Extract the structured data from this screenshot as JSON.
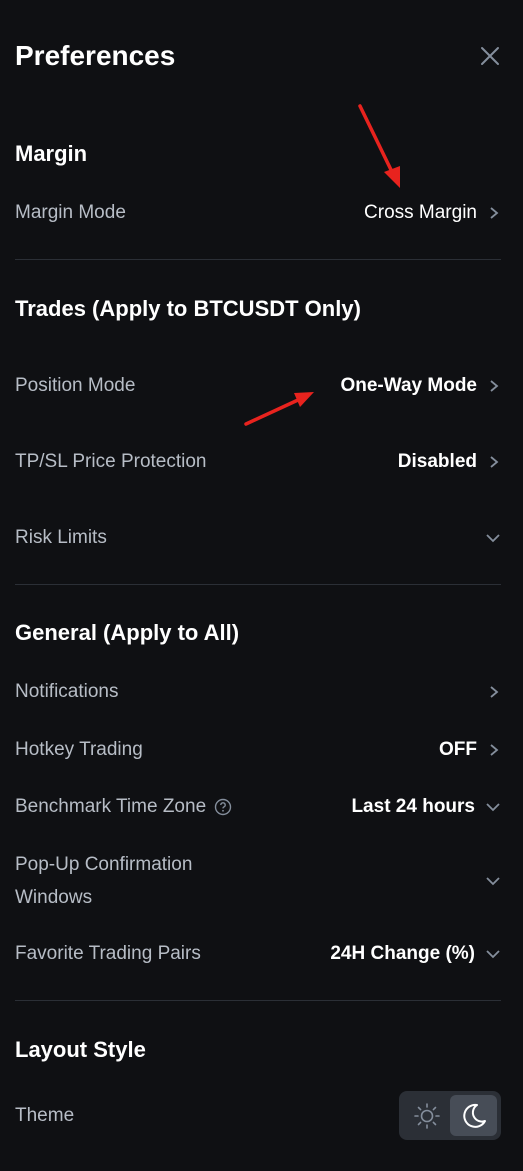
{
  "header": {
    "title": "Preferences"
  },
  "margin": {
    "section_title": "Margin",
    "mode_label": "Margin Mode",
    "mode_value": "Cross Margin"
  },
  "trades": {
    "section_title": "Trades (Apply to BTCUSDT Only)",
    "position_mode_label": "Position Mode",
    "position_mode_value": "One-Way Mode",
    "tpsl_label": "TP/SL Price Protection",
    "tpsl_value": "Disabled",
    "risk_limits_label": "Risk Limits"
  },
  "general": {
    "section_title": "General (Apply to All)",
    "notifications_label": "Notifications",
    "hotkey_label": "Hotkey Trading",
    "hotkey_value": "OFF",
    "timezone_label": "Benchmark Time Zone",
    "timezone_value": "Last 24 hours",
    "popup_label_line1": "Pop-Up Confirmation",
    "popup_label_line2": "Windows",
    "favorites_label": "Favorite Trading Pairs",
    "favorites_value": "24H Change (%)"
  },
  "layout": {
    "section_title": "Layout Style",
    "theme_label": "Theme",
    "theme_selected": "dark"
  },
  "colors": {
    "background": "#0f1013",
    "text_primary": "#ffffff",
    "text_secondary": "#b7bdc6",
    "divider": "#2b2f36",
    "annotation_arrow": "#e8231e"
  }
}
